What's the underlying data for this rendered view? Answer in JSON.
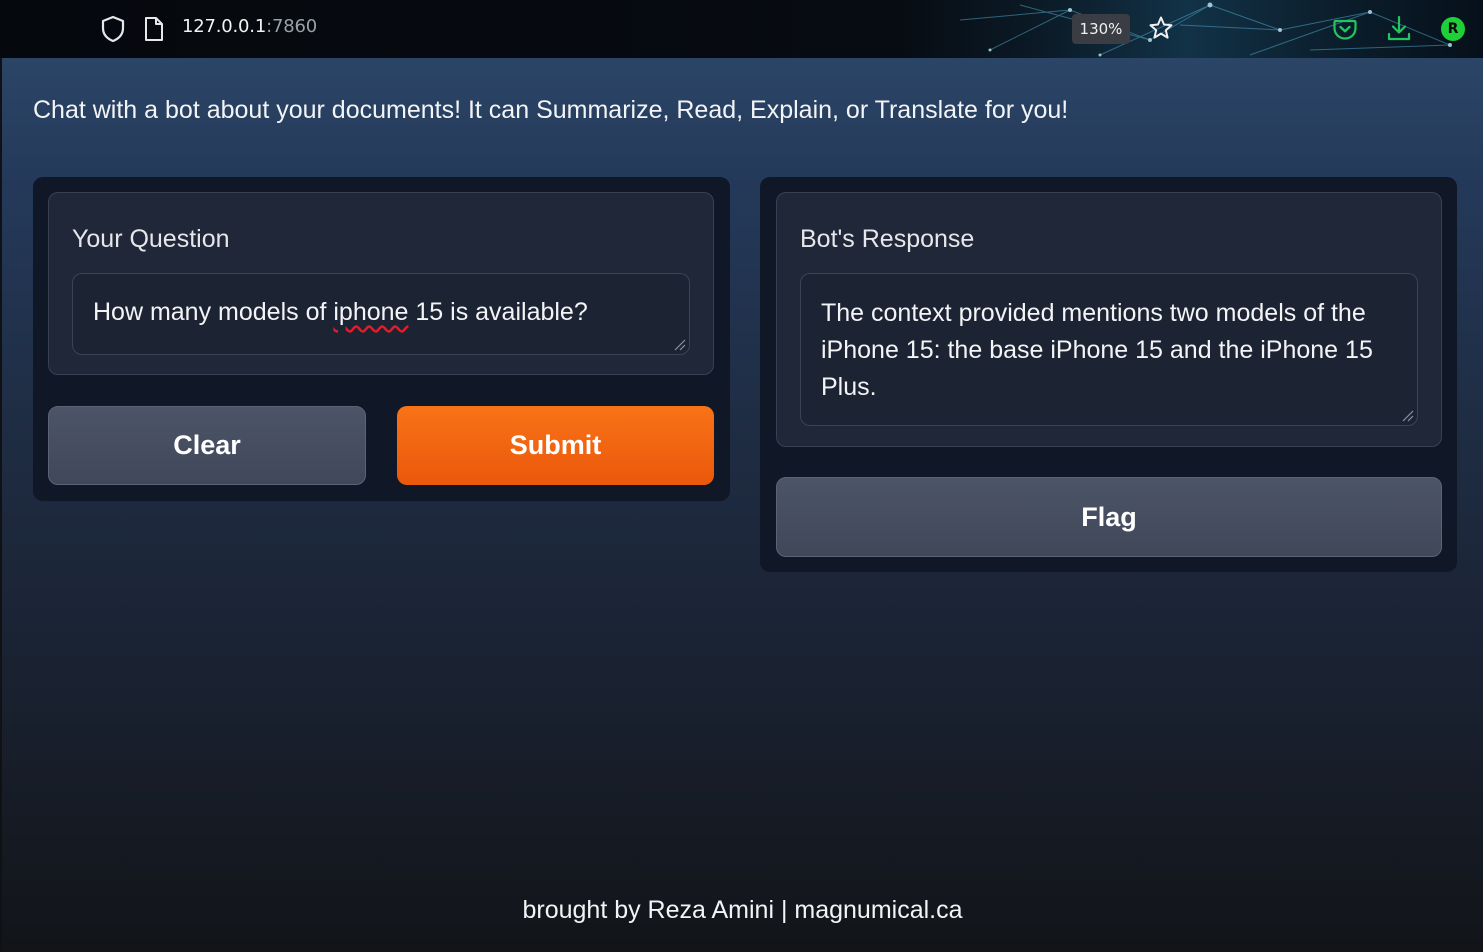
{
  "browser": {
    "url_host": "127.0.0.1",
    "url_port": ":7860",
    "zoom_level": "130%",
    "account_initial": "R",
    "icons": [
      "shield-icon",
      "page-icon",
      "star-icon",
      "pocket-icon",
      "download-icon"
    ]
  },
  "app": {
    "description": "Chat with a bot about your documents! It can Summarize, Read, Explain, or Translate for you!",
    "question": {
      "label": "Your Question",
      "value_before": "How many models of ",
      "value_misspelled": "iphone",
      "value_after": " 15 is available?"
    },
    "response": {
      "label": "Bot's Response",
      "value": "The context provided mentions two models of the iPhone 15: the base iPhone 15 and the iPhone 15 Plus."
    },
    "buttons": {
      "clear": "Clear",
      "submit": "Submit",
      "flag": "Flag"
    },
    "footer": "brought by Reza Amini | magnumical.ca"
  },
  "colors": {
    "accent": "#f97316",
    "panel": "#101726",
    "block": "#1f2738",
    "secondary_button": "#4c5567",
    "pocket": "#22c55e"
  }
}
